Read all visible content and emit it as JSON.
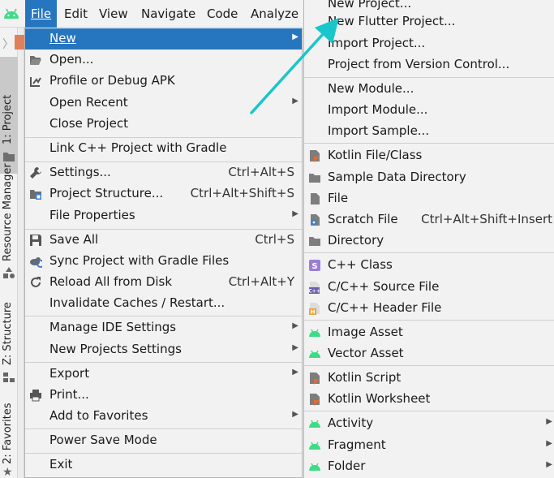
{
  "menubar": {
    "items": [
      {
        "label": "File",
        "mnemonic_index": 0
      },
      {
        "label": "Edit",
        "mnemonic_index": 0
      },
      {
        "label": "View",
        "mnemonic_index": 0
      },
      {
        "label": "Navigate",
        "mnemonic_index": 0
      },
      {
        "label": "Code",
        "mnemonic_index": 0
      },
      {
        "label": "Analyze",
        "mnemonic_index": 1
      }
    ]
  },
  "tool_tabs": {
    "project": "1: Project",
    "resource_manager": "Resource Manager",
    "structure": "Z: Structure",
    "favorites": "2: Favorites"
  },
  "file_menu": {
    "items": [
      {
        "label": "New",
        "shortcut": "",
        "submenu": true,
        "highlighted": true,
        "icon": "none"
      },
      {
        "label": "Open...",
        "shortcut": "",
        "icon": "folder-open-icon"
      },
      {
        "label": "Profile or Debug APK",
        "shortcut": "",
        "icon": "profile-apk-icon"
      },
      {
        "label": "Open Recent",
        "shortcut": "",
        "submenu": true,
        "icon": "none"
      },
      {
        "label": "Close Project",
        "shortcut": "",
        "icon": "none"
      },
      {
        "label": "Link C++ Project with Gradle",
        "shortcut": "",
        "icon": "none"
      },
      {
        "label": "Settings...",
        "shortcut": "Ctrl+Alt+S",
        "icon": "wrench-icon"
      },
      {
        "label": "Project Structure...",
        "shortcut": "Ctrl+Alt+Shift+S",
        "icon": "project-structure-icon"
      },
      {
        "label": "File Properties",
        "shortcut": "",
        "submenu": true,
        "icon": "none"
      },
      {
        "label": "Save All",
        "shortcut": "Ctrl+S",
        "icon": "save-icon"
      },
      {
        "label": "Sync Project with Gradle Files",
        "shortcut": "",
        "icon": "gradle-sync-icon"
      },
      {
        "label": "Reload All from Disk",
        "shortcut": "Ctrl+Alt+Y",
        "icon": "reload-icon"
      },
      {
        "label": "Invalidate Caches / Restart...",
        "shortcut": "",
        "icon": "none"
      },
      {
        "label": "Manage IDE Settings",
        "shortcut": "",
        "submenu": true,
        "icon": "none"
      },
      {
        "label": "New Projects Settings",
        "shortcut": "",
        "submenu": true,
        "icon": "none"
      },
      {
        "label": "Export",
        "shortcut": "",
        "submenu": true,
        "icon": "none"
      },
      {
        "label": "Print...",
        "shortcut": "",
        "icon": "printer-icon"
      },
      {
        "label": "Add to Favorites",
        "shortcut": "",
        "submenu": true,
        "icon": "none"
      },
      {
        "label": "Power Save Mode",
        "shortcut": "",
        "icon": "none"
      },
      {
        "label": "Exit",
        "shortcut": "",
        "icon": "none"
      }
    ]
  },
  "new_submenu": {
    "items": [
      {
        "label": "New Project...",
        "shortcut": "",
        "icon": "none"
      },
      {
        "label": "New Flutter Project...",
        "shortcut": "",
        "icon": "none"
      },
      {
        "label": "Import Project...",
        "shortcut": "",
        "icon": "none"
      },
      {
        "label": "Project from Version Control...",
        "shortcut": "",
        "icon": "none"
      },
      {
        "label": "New Module...",
        "shortcut": "",
        "icon": "none"
      },
      {
        "label": "Import Module...",
        "shortcut": "",
        "icon": "none"
      },
      {
        "label": "Import Sample...",
        "shortcut": "",
        "icon": "none"
      },
      {
        "label": "Kotlin File/Class",
        "shortcut": "",
        "icon": "kotlin-file-icon"
      },
      {
        "label": "Sample Data Directory",
        "shortcut": "",
        "icon": "folder-icon"
      },
      {
        "label": "File",
        "shortcut": "",
        "icon": "file-icon"
      },
      {
        "label": "Scratch File",
        "shortcut": "Ctrl+Alt+Shift+Insert",
        "icon": "scratch-file-icon"
      },
      {
        "label": "Directory",
        "shortcut": "",
        "icon": "folder-icon"
      },
      {
        "label": "C++ Class",
        "shortcut": "",
        "icon": "cpp-class-icon"
      },
      {
        "label": "C/C++ Source File",
        "shortcut": "",
        "icon": "cpp-source-icon"
      },
      {
        "label": "C/C++ Header File",
        "shortcut": "",
        "icon": "cpp-header-icon"
      },
      {
        "label": "Image Asset",
        "shortcut": "",
        "icon": "android-icon"
      },
      {
        "label": "Vector Asset",
        "shortcut": "",
        "icon": "android-icon"
      },
      {
        "label": "Kotlin Script",
        "shortcut": "",
        "icon": "kotlin-script-icon"
      },
      {
        "label": "Kotlin Worksheet",
        "shortcut": "",
        "icon": "kotlin-worksheet-icon"
      },
      {
        "label": "Activity",
        "shortcut": "",
        "submenu": true,
        "icon": "android-icon"
      },
      {
        "label": "Fragment",
        "shortcut": "",
        "submenu": true,
        "icon": "android-icon"
      },
      {
        "label": "Folder",
        "shortcut": "",
        "submenu": true,
        "icon": "android-icon"
      }
    ]
  },
  "colors": {
    "highlight": "#2675bf",
    "menu_bg": "#f2f2f2",
    "android_green": "#3ddc84",
    "annotation_arrow": "#19c6cc"
  }
}
